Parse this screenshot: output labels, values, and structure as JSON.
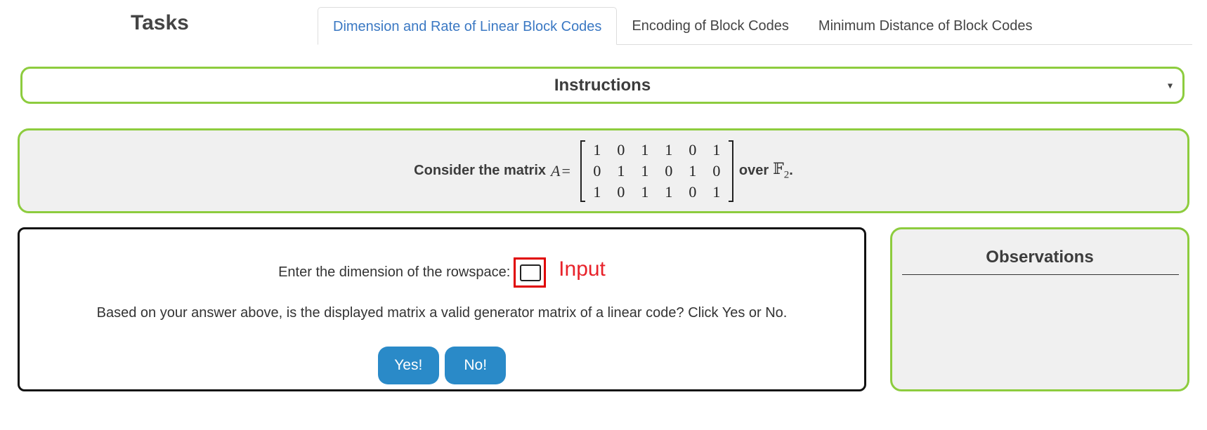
{
  "tasks_title": "Tasks",
  "tabs": [
    {
      "label": "Dimension and Rate of Linear Block Codes",
      "active": true
    },
    {
      "label": "Encoding of Block Codes",
      "active": false
    },
    {
      "label": "Minimum Distance of Block Codes",
      "active": false
    }
  ],
  "instructions": {
    "label": "Instructions",
    "caret": "▾"
  },
  "problem": {
    "prefix": "Consider the matrix",
    "matrix_symbol": "A",
    "equals": "=",
    "matrix": [
      [
        "1",
        "0",
        "1",
        "1",
        "0",
        "1"
      ],
      [
        "0",
        "1",
        "1",
        "0",
        "1",
        "0"
      ],
      [
        "1",
        "0",
        "1",
        "1",
        "0",
        "1"
      ]
    ],
    "over": "over",
    "field_letter": "𝔽",
    "field_sub": "2",
    "period": "."
  },
  "answer": {
    "dimension_prompt": "Enter the dimension of the rowspace:",
    "dimension_value": "",
    "input_tag": "Input",
    "question": "Based on your answer above, is the displayed matrix a valid generator matrix of a linear code? Click Yes or No.",
    "yes_label": "Yes!",
    "no_label": "No!"
  },
  "observations": {
    "title": "Observations"
  },
  "colors": {
    "accent_green": "#8dcc3e",
    "button_blue": "#2a8ac8",
    "active_tab_blue": "#3a78c3",
    "annotation_red": "#e8222a"
  }
}
